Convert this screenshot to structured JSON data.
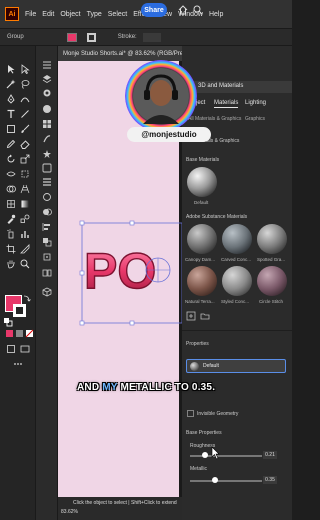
{
  "menubar": {
    "logo": "Ai",
    "items": [
      "File",
      "Edit",
      "Object",
      "Type",
      "Select",
      "Effect",
      "View",
      "Window",
      "Help"
    ],
    "share_label": "Share"
  },
  "controlbar": {
    "selection_label": "Group",
    "stroke_label": "Stroke:"
  },
  "document": {
    "tab_title": "Monje Studio Shorts.ai* @ 83.62% (RGB/Preview) (Trim View)",
    "zoom": "83.62%",
    "status_text": "Click the object to select  |  Shift+Click to extend"
  },
  "artwork": {
    "letters": "PO"
  },
  "overlay": {
    "handle": "@monjestudio"
  },
  "caption": {
    "before": "AND ",
    "highlight": "MY",
    "after": " METALLIC TO 0.35."
  },
  "panel": {
    "title": "3D and Materials",
    "tabs": [
      "Object",
      "Materials",
      "Lighting"
    ],
    "active_tab": "Materials",
    "subtabs": [
      "All Materials & Graphics",
      "Graphics"
    ],
    "subtab_all": "All Materials & Graphics",
    "subtab_graphics": "Graphics",
    "all_materials_heading": "All Materials & Graphics",
    "base_materials_heading": "Base Materials",
    "base_material": "Default",
    "adobe_heading": "Adobe Substance Materials",
    "substance_materials": [
      "Canopy Dam...",
      "Carved Conc...",
      "Spotted Gra...",
      "Natural Terra...",
      "Styled Conc...",
      "Circle Stitch"
    ],
    "properties_heading": "Properties",
    "selected_material": "Default",
    "invisible_geometry_label": "Invisible Geometry",
    "base_properties_heading": "Base Properties",
    "roughness_label": "Roughness",
    "roughness_value": "0.21",
    "roughness_fraction": 0.21,
    "metallic_label": "Metallic",
    "metallic_value": "0.35",
    "metallic_fraction": 0.35
  },
  "colors": {
    "fill": "#e8386a",
    "canvas": "#f0d6e6",
    "accent": "#2b6ce0",
    "caption_highlight": "#6fb6ff"
  }
}
